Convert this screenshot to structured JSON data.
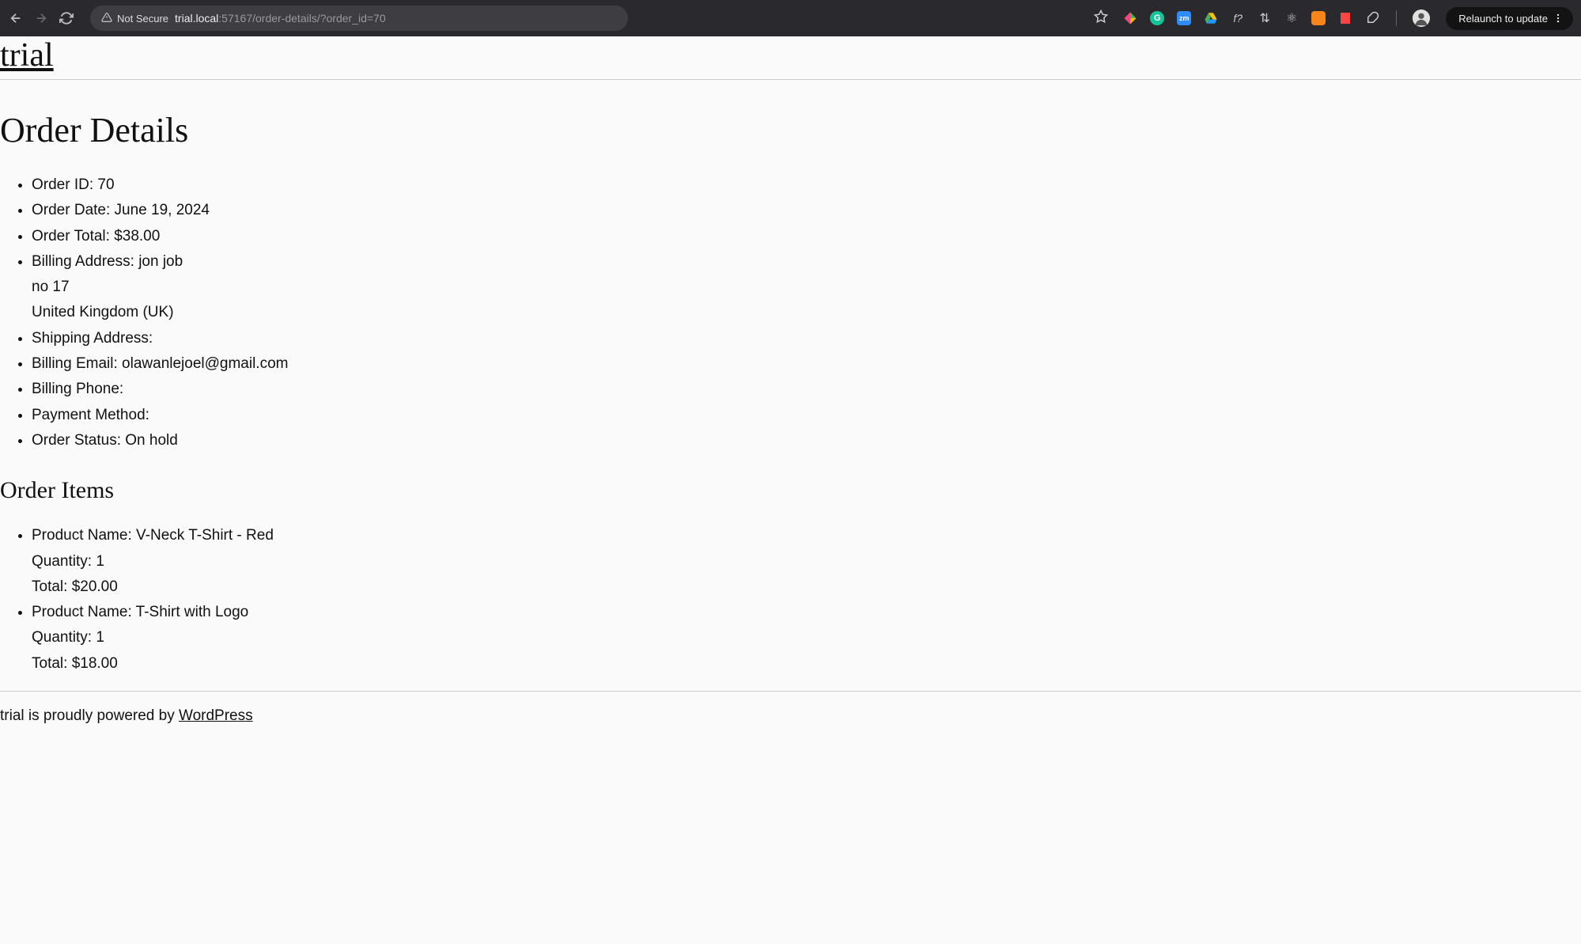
{
  "browser": {
    "security_label": "Not Secure",
    "url_domain": "trial.local",
    "url_port": ":57167",
    "url_path": "/order-details/?order_id=70",
    "relaunch_label": "Relaunch to update"
  },
  "site": {
    "title": "trial"
  },
  "page": {
    "heading": "Order Details",
    "items_heading": "Order Items"
  },
  "order": {
    "id_label": "Order ID:",
    "id_value": "70",
    "date_label": "Order Date:",
    "date_value": "June 19, 2024",
    "total_label": "Order Total:",
    "total_value": "$38.00",
    "billing_address_label": "Billing Address:",
    "billing_address_line1": "jon job",
    "billing_address_line2": "no 17",
    "billing_address_line3": "United Kingdom (UK)",
    "shipping_address_label": "Shipping Address:",
    "shipping_address_value": "",
    "billing_email_label": "Billing Email:",
    "billing_email_value": "olawanlejoel@gmail.com",
    "billing_phone_label": "Billing Phone:",
    "billing_phone_value": "",
    "payment_method_label": "Payment Method:",
    "payment_method_value": "",
    "status_label": "Order Status:",
    "status_value": "On hold"
  },
  "items": [
    {
      "name_label": "Product Name:",
      "name_value": "V-Neck T-Shirt - Red",
      "qty_label": "Quantity:",
      "qty_value": "1",
      "total_label": "Total:",
      "total_value": "$20.00"
    },
    {
      "name_label": "Product Name:",
      "name_value": "T-Shirt with Logo",
      "qty_label": "Quantity:",
      "qty_value": "1",
      "total_label": "Total:",
      "total_value": "$18.00"
    }
  ],
  "footer": {
    "prefix": "trial is proudly powered by ",
    "link_text": "WordPress"
  }
}
